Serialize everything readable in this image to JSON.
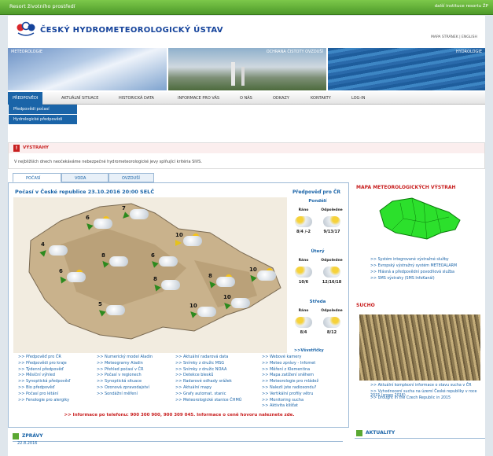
{
  "topbar": {
    "left": "Resort životního prostředí",
    "right": "další instituce resortu ŽP"
  },
  "header": {
    "title": "ČESKÝ HYDROMETEOROLOGICKÝ ÚSTAV",
    "links": "MAPA STRÁNEK | ENGLISH"
  },
  "banners": {
    "b1": "METEOROLOGIE",
    "b2": "OCHRANA ČISTOTY OVZDUŠÍ",
    "b3": "HYDROLOGIE"
  },
  "nav": [
    "PŘEDPOVĚDI",
    "AKTUÁLNÍ SITUACE",
    "HISTORICKÁ DATA",
    "INFORMACE PRO VÁS",
    "O NÁS",
    "ODKAZY",
    "KONTAKTY",
    "LOG-IN"
  ],
  "subnav": [
    "Předpovědi počasí",
    "Hydrologické předpovědi"
  ],
  "warnings": {
    "title": "VÝSTRAHY",
    "text": "V nejbližších dnech neočekáváme nebezpečné hydrometeorologické jevy splňující kritéria SIVS."
  },
  "tabs": [
    "POČASÍ",
    "VODA",
    "OVZDUŠÍ"
  ],
  "weather": {
    "heading": "Počasí v České republice 23.10.2016 20:00 SELČ",
    "temps": [
      "6",
      "7",
      "4",
      "6",
      "8",
      "6",
      "10",
      "8",
      "5",
      "8",
      "10",
      "10",
      "10"
    ],
    "forecast": {
      "title": "Předpověď pro ČR",
      "col1": "Ráno",
      "col2": "Odpoledne",
      "days": [
        {
          "name": "Pondělí",
          "morning": "8/4 /-2",
          "afternoon": "9/13/17"
        },
        {
          "name": "Úterý",
          "morning": "10/6",
          "afternoon": "12/16/18"
        },
        {
          "name": "Středa",
          "morning": "8/4",
          "afternoon": "8/12"
        }
      ],
      "more": ">>Všvstřičky"
    },
    "links": [
      [
        "Předpověď pro ČR",
        "Předpovědi pro kraje",
        "Týdenní předpověď",
        "Měsíční výhled",
        "Synoptická předpověď",
        "Bio předpověď",
        "Počasí pro létání",
        "Fenologie pro alergiky"
      ],
      [
        "Numerický model Aladin",
        "Meteogramy Aladin",
        "Přehled počasí v ČR",
        "Počasí v regionech",
        "Synoptická situace",
        "Ozonová zpravodajství",
        "Sondážní měření"
      ],
      [
        "Aktuální radarová data",
        "Snímky z družic MSG",
        "Snímky z družic NOAA",
        "Detekce blesků",
        "Radarové odhady srážek",
        "Aktuální mapy",
        "Grafy automat. stanic",
        "Meteorologické stanice ČHMÚ"
      ],
      [
        "Webové kamery",
        "Meteo zprávy - Infomet",
        "Měření z Klementina",
        "Mapa zatížení sněhem",
        "Meteorologie pro mládež",
        "Nalezli jste radiosondu?",
        "Vertikální profily větru",
        "Monitoring sucha",
        "Aktivita klíšťat"
      ]
    ],
    "info": ">> Informace po telefonu:  900 300 900,  900 309 045.     Informace o ceně hovoru naleznete zde."
  },
  "side": {
    "map_title": "MAPA METEOROLOGICKÝCH VÝSTRAH",
    "map_links": [
      "Systém integrované výstražné služby",
      "Evropský výstražný systém METEOALARM",
      "Hlásná a předpovědní povodňová služba",
      "SMS výstrahy (SMS InfoKanál)"
    ],
    "drought_title": "SUCHO",
    "drought_links": [
      "Aktuální komplexní informace o stavu sucha v ČR",
      "Vyhodnocení sucha na území České republiky v roce 2015 (srpen 2016)",
      "Drought in the Czech Republic in 2015"
    ],
    "news": "AKTUALITY"
  },
  "bottom": {
    "news": "ZPRÁVY",
    "date": "22.8.2016"
  },
  "colors": {
    "brand": "#15439b",
    "accent": "#1a64a8",
    "alert": "#c81f1f",
    "green": "#5aa832"
  }
}
